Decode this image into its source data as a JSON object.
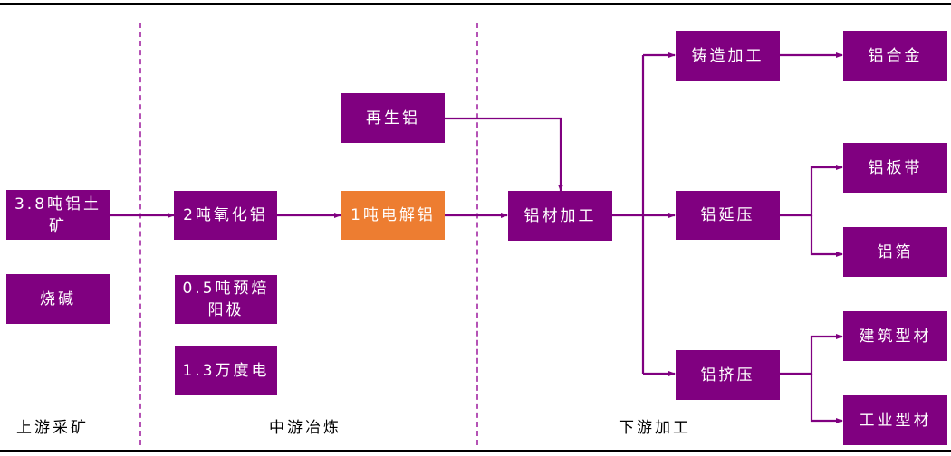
{
  "diagram": {
    "stages": [
      {
        "id": "upstream",
        "label": "上游采矿"
      },
      {
        "id": "midstream",
        "label": "中游冶炼"
      },
      {
        "id": "downstream",
        "label": "下游加工"
      }
    ],
    "nodes": {
      "bauxite": "3.8吨铝土矿",
      "caustic_soda": "烧碱",
      "alumina": "2吨氧化铝",
      "anode": "0.5吨预焙阳极",
      "electricity": "1.3万度电",
      "electrolytic_al": "1吨电解铝",
      "recycled_al": "再生铝",
      "al_processing": "铝材加工",
      "casting": "铸造加工",
      "rolling": "铝延压",
      "extrusion": "铝挤压",
      "al_alloy": "铝合金",
      "al_sheet": "铝板带",
      "al_foil": "铝箔",
      "building_profile": "建筑型材",
      "industrial_profile": "工业型材"
    },
    "edges": [
      [
        "bauxite",
        "alumina"
      ],
      [
        "alumina",
        "electrolytic_al"
      ],
      [
        "electrolytic_al",
        "al_processing"
      ],
      [
        "recycled_al",
        "al_processing"
      ],
      [
        "al_processing",
        "casting"
      ],
      [
        "al_processing",
        "rolling"
      ],
      [
        "al_processing",
        "extrusion"
      ],
      [
        "casting",
        "al_alloy"
      ],
      [
        "rolling",
        "al_sheet"
      ],
      [
        "rolling",
        "al_foil"
      ],
      [
        "extrusion",
        "building_profile"
      ],
      [
        "extrusion",
        "industrial_profile"
      ]
    ],
    "colors": {
      "node": "#800080",
      "highlight": "#ed7d31",
      "divider": "#b552b5",
      "text": "#ffffff"
    }
  }
}
